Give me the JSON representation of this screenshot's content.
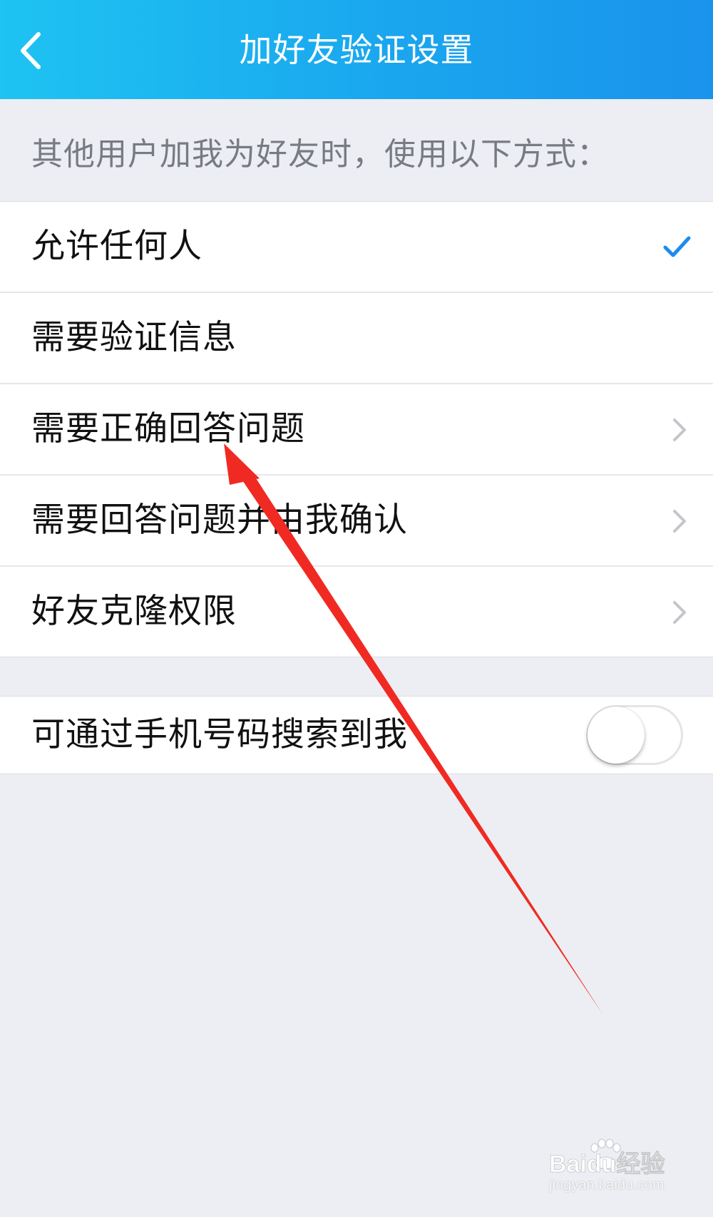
{
  "header": {
    "title": "加好友验证设置",
    "back_icon": "chevron-left-icon",
    "gradient_colors": [
      "#1ec3f2",
      "#1a93ec"
    ]
  },
  "caption": "其他用户加我为好友时，使用以下方式：",
  "options": [
    {
      "label": "允许任何人",
      "selected": true,
      "trailing": "check-icon"
    },
    {
      "label": "需要验证信息",
      "selected": false,
      "trailing": "none"
    },
    {
      "label": "需要正确回答问题",
      "selected": false,
      "trailing": "chevron-right-icon"
    },
    {
      "label": "需要回答问题并由我确认",
      "selected": false,
      "trailing": "chevron-right-icon"
    },
    {
      "label": "好友克隆权限",
      "selected": false,
      "trailing": "chevron-right-icon"
    }
  ],
  "phone_search": {
    "label": "可通过手机号码搜索到我",
    "enabled": false
  },
  "annotation": {
    "type": "arrow",
    "color": "#f02a22",
    "points_to": "需要正确回答问题"
  },
  "watermark": {
    "brand": "Baidu经验",
    "url": "jingyan.baidu.com"
  },
  "colors": {
    "accent_check": "#1a8cf0",
    "background": "#eceef3",
    "caption_text": "#777b82"
  }
}
